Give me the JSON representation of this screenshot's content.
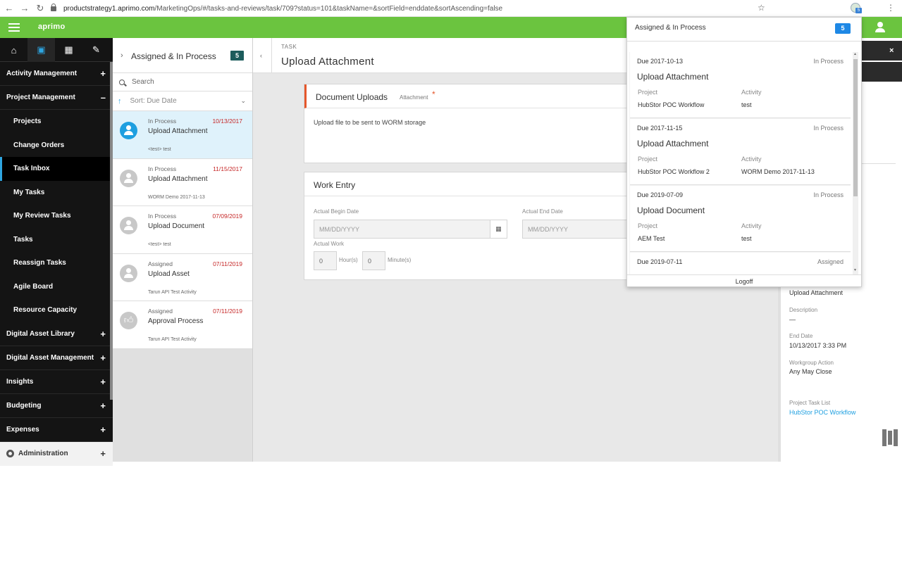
{
  "browser": {
    "url_host": "productstrategy1.aprimo.com",
    "url_path": "/MarketingOps/#/tasks-and-reviews/task/709?status=101&taskName=&sortField=enddate&sortAscending=false",
    "ext_badge": "5"
  },
  "header": {
    "brand": "aprimo"
  },
  "nav": {
    "items": [
      {
        "label": "Activity Management",
        "toggle": "+"
      },
      {
        "label": "Project Management",
        "toggle": "–"
      }
    ],
    "sub_items": [
      "Projects",
      "Change Orders",
      "Task Inbox",
      "My Tasks",
      "My Review Tasks",
      "Tasks",
      "Reassign Tasks",
      "Agile Board",
      "Resource Capacity"
    ],
    "items2": [
      {
        "label": "Digital Asset Library",
        "toggle": "+"
      },
      {
        "label": "Digital Asset Management",
        "toggle": "+"
      },
      {
        "label": "Insights",
        "toggle": "+"
      },
      {
        "label": "Budgeting",
        "toggle": "+"
      },
      {
        "label": "Expenses",
        "toggle": "+"
      }
    ],
    "admin": {
      "label": "Administration",
      "toggle": "+"
    }
  },
  "task_list": {
    "title": "Assigned & In Process",
    "count": "5",
    "search_placeholder": "Search",
    "sort_label": "Sort: Due Date",
    "cards": [
      {
        "status": "In Process",
        "date": "10/13/2017",
        "title": "Upload Attachment",
        "sub": "<test> test"
      },
      {
        "status": "In Process",
        "date": "11/15/2017",
        "title": "Upload Attachment",
        "sub": "WORM Demo 2017-11-13"
      },
      {
        "status": "In Process",
        "date": "07/09/2019",
        "title": "Upload Document",
        "sub": "<test> test"
      },
      {
        "status": "Assigned",
        "date": "07/11/2019",
        "title": "Upload Asset",
        "sub": "Tarun API Test Activity"
      },
      {
        "status": "Assigned",
        "date": "07/11/2019",
        "title": "Approval Process",
        "sub": "Tarun API Test Activity"
      }
    ]
  },
  "main": {
    "label": "TASK",
    "title": "Upload Attachment",
    "uploads": {
      "heading": "Document Uploads",
      "sub": "Attachment",
      "required": "*",
      "text": "Upload file to be sent to WORM storage"
    },
    "work": {
      "heading": "Work Entry",
      "begin_label": "Actual Begin Date",
      "end_label": "Actual End Date",
      "date_placeholder": "MM/DD/YYYY",
      "work_label": "Actual Work",
      "hours_value": "0",
      "hours_unit": "Hour(s)",
      "minutes_value": "0",
      "minutes_unit": "Minute(s)"
    }
  },
  "right_panel": {
    "close": "×",
    "task_name": "Upload Attachment",
    "desc_label": "Description",
    "desc_value": "—",
    "end_label": "End Date",
    "end_value": "10/13/2017 3:33 PM",
    "wg_label": "Workgroup Action",
    "wg_value": "Any May Close",
    "ptl_label": "Project Task List",
    "ptl_value": "HubStor POC Workflow"
  },
  "popup": {
    "title": "Assigned & In Process",
    "count": "5",
    "project_label": "Project",
    "activity_label": "Activity",
    "cards": [
      {
        "due": "Due 2017-10-13",
        "status": "In Process",
        "title": "Upload Attachment",
        "project": "HubStor POC Workflow",
        "activity": "test"
      },
      {
        "due": "Due 2017-11-15",
        "status": "In Process",
        "title": "Upload Attachment",
        "project": "HubStor POC Workflow 2",
        "activity": "WORM Demo 2017-11-13"
      },
      {
        "due": "Due 2019-07-09",
        "status": "In Process",
        "title": "Upload Document",
        "project": "AEM Test",
        "activity": "test"
      },
      {
        "due": "Due 2019-07-11",
        "status": "Assigned",
        "title": "",
        "project": "",
        "activity": ""
      }
    ],
    "logoff": "Logoff"
  }
}
